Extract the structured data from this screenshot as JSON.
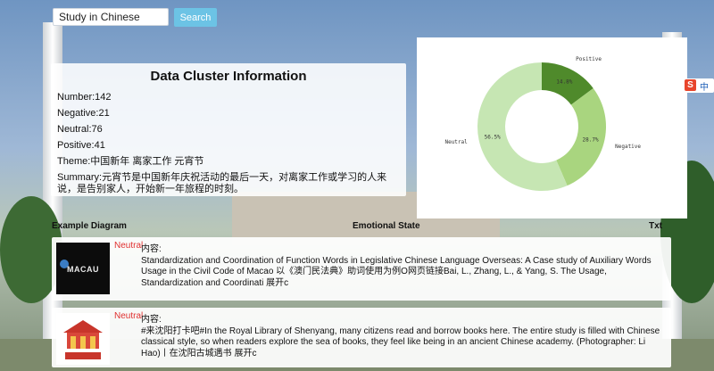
{
  "search": {
    "value": "Study in Chinese",
    "button_label": "Search"
  },
  "info": {
    "title": "Data Cluster Information",
    "number": "Number:142",
    "negative": "Negative:21",
    "neutral": "Neutral:76",
    "positive": "Positive:41",
    "theme": "Theme:中国新年 离家工作 元宵节",
    "summary": "Summary:元宵节是中国新年庆祝活动的最后一天，对离家工作或学习的人来说，是告别家人，开始新一年旅程的时刻。"
  },
  "section_headers": {
    "example_diagram": "Example Diagram",
    "emotional_state": "Emotional State",
    "txt": "Txt"
  },
  "records": [
    {
      "sentiment": "Neutral",
      "thumb_label": "MACAU",
      "content_label": "内容:",
      "text": "Standardization and Coordination of Function Words in Legislative Chinese Language Overseas: A Case study of Auxiliary Words Usage in the Civil Code of Macao 以《澳门民法典》助词使用为例O网页链接Bai, L., Zhang, L., & Yang, S. The Usage, Standardization and Coordinati 展开c"
    },
    {
      "sentiment": "Neutral",
      "thumb_label": "",
      "content_label": "内容:",
      "text": "#来沈阳打卡吧#In the Royal Library of Shenyang, many citizens read and borrow books here. The entire study is filled with Chinese classical style, so when readers explore the sea of books, they feel like being in an ancient Chinese academy. (Photographer: Li Hao)丨在沈阳古城遇书 展开c"
    }
  ],
  "side_badge": {
    "s": "S",
    "text": "中"
  },
  "colors": {
    "positive": "#4f8a2b",
    "negative": "#a9d57f",
    "neutral": "#c6e6b3",
    "accent": "#6cc3e5",
    "sentiment_text": "#e03030"
  },
  "chart_data": {
    "type": "pie",
    "donut": true,
    "slices": [
      {
        "label": "Positive",
        "value": 14.8,
        "display": "14.8%",
        "color": "#4f8a2b"
      },
      {
        "label": "Negative",
        "value": 28.7,
        "display": "28.7%",
        "color": "#a9d57f"
      },
      {
        "label": "Neutral",
        "value": 56.5,
        "display": "56.5%",
        "color": "#c6e6b3"
      }
    ],
    "legend": "none"
  }
}
